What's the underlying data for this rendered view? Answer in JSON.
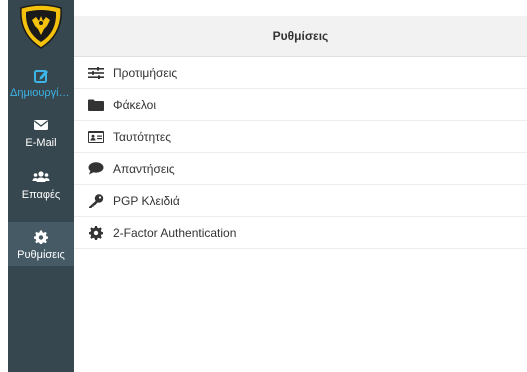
{
  "sidebar": {
    "items": [
      {
        "label": "Δημιουργία...",
        "icon": "edit-icon"
      },
      {
        "label": "E-Mail",
        "icon": "envelope-icon"
      },
      {
        "label": "Επαφές",
        "icon": "users-icon"
      },
      {
        "label": "Ρυθμίσεις",
        "icon": "gear-icon",
        "active": true
      }
    ]
  },
  "header": {
    "title": "Ρυθμίσεις"
  },
  "menu": {
    "items": [
      {
        "label": "Προτιμήσεις",
        "icon": "sliders-icon"
      },
      {
        "label": "Φάκελοι",
        "icon": "folder-icon"
      },
      {
        "label": "Ταυτότητες",
        "icon": "id-card-icon"
      },
      {
        "label": "Απαντήσεις",
        "icon": "comment-icon"
      },
      {
        "label": "PGP Κλειδιά",
        "icon": "key-icon"
      },
      {
        "label": "2-Factor Authentication",
        "icon": "gear-icon"
      }
    ]
  },
  "colors": {
    "sidebar_bg": "#37474f",
    "sidebar_active": "#455a64",
    "accent": "#3cb4e6",
    "logo_yellow": "#f4c20d",
    "header_bg": "#f2f2f2"
  }
}
